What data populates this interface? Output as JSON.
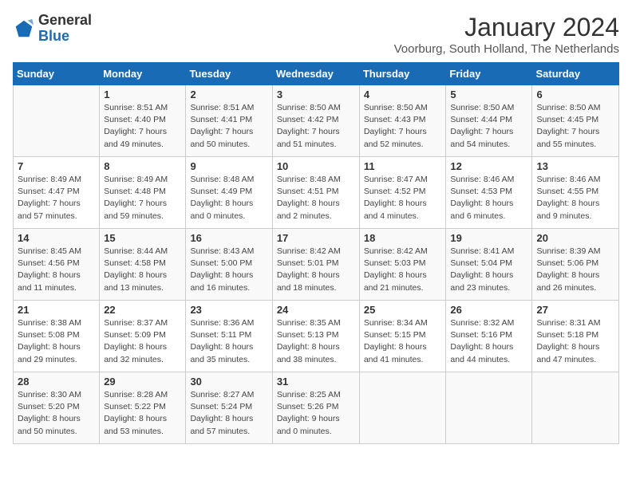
{
  "header": {
    "logo_general": "General",
    "logo_blue": "Blue",
    "title": "January 2024",
    "subtitle": "Voorburg, South Holland, The Netherlands"
  },
  "weekdays": [
    "Sunday",
    "Monday",
    "Tuesday",
    "Wednesday",
    "Thursday",
    "Friday",
    "Saturday"
  ],
  "weeks": [
    [
      {
        "day": "",
        "sunrise": "",
        "sunset": "",
        "daylight": ""
      },
      {
        "day": "1",
        "sunrise": "8:51 AM",
        "sunset": "4:40 PM",
        "daylight": "7 hours and 49 minutes."
      },
      {
        "day": "2",
        "sunrise": "8:51 AM",
        "sunset": "4:41 PM",
        "daylight": "7 hours and 50 minutes."
      },
      {
        "day": "3",
        "sunrise": "8:50 AM",
        "sunset": "4:42 PM",
        "daylight": "7 hours and 51 minutes."
      },
      {
        "day": "4",
        "sunrise": "8:50 AM",
        "sunset": "4:43 PM",
        "daylight": "7 hours and 52 minutes."
      },
      {
        "day": "5",
        "sunrise": "8:50 AM",
        "sunset": "4:44 PM",
        "daylight": "7 hours and 54 minutes."
      },
      {
        "day": "6",
        "sunrise": "8:50 AM",
        "sunset": "4:45 PM",
        "daylight": "7 hours and 55 minutes."
      }
    ],
    [
      {
        "day": "7",
        "sunrise": "8:49 AM",
        "sunset": "4:47 PM",
        "daylight": "7 hours and 57 minutes."
      },
      {
        "day": "8",
        "sunrise": "8:49 AM",
        "sunset": "4:48 PM",
        "daylight": "7 hours and 59 minutes."
      },
      {
        "day": "9",
        "sunrise": "8:48 AM",
        "sunset": "4:49 PM",
        "daylight": "8 hours and 0 minutes."
      },
      {
        "day": "10",
        "sunrise": "8:48 AM",
        "sunset": "4:51 PM",
        "daylight": "8 hours and 2 minutes."
      },
      {
        "day": "11",
        "sunrise": "8:47 AM",
        "sunset": "4:52 PM",
        "daylight": "8 hours and 4 minutes."
      },
      {
        "day": "12",
        "sunrise": "8:46 AM",
        "sunset": "4:53 PM",
        "daylight": "8 hours and 6 minutes."
      },
      {
        "day": "13",
        "sunrise": "8:46 AM",
        "sunset": "4:55 PM",
        "daylight": "8 hours and 9 minutes."
      }
    ],
    [
      {
        "day": "14",
        "sunrise": "8:45 AM",
        "sunset": "4:56 PM",
        "daylight": "8 hours and 11 minutes."
      },
      {
        "day": "15",
        "sunrise": "8:44 AM",
        "sunset": "4:58 PM",
        "daylight": "8 hours and 13 minutes."
      },
      {
        "day": "16",
        "sunrise": "8:43 AM",
        "sunset": "5:00 PM",
        "daylight": "8 hours and 16 minutes."
      },
      {
        "day": "17",
        "sunrise": "8:42 AM",
        "sunset": "5:01 PM",
        "daylight": "8 hours and 18 minutes."
      },
      {
        "day": "18",
        "sunrise": "8:42 AM",
        "sunset": "5:03 PM",
        "daylight": "8 hours and 21 minutes."
      },
      {
        "day": "19",
        "sunrise": "8:41 AM",
        "sunset": "5:04 PM",
        "daylight": "8 hours and 23 minutes."
      },
      {
        "day": "20",
        "sunrise": "8:39 AM",
        "sunset": "5:06 PM",
        "daylight": "8 hours and 26 minutes."
      }
    ],
    [
      {
        "day": "21",
        "sunrise": "8:38 AM",
        "sunset": "5:08 PM",
        "daylight": "8 hours and 29 minutes."
      },
      {
        "day": "22",
        "sunrise": "8:37 AM",
        "sunset": "5:09 PM",
        "daylight": "8 hours and 32 minutes."
      },
      {
        "day": "23",
        "sunrise": "8:36 AM",
        "sunset": "5:11 PM",
        "daylight": "8 hours and 35 minutes."
      },
      {
        "day": "24",
        "sunrise": "8:35 AM",
        "sunset": "5:13 PM",
        "daylight": "8 hours and 38 minutes."
      },
      {
        "day": "25",
        "sunrise": "8:34 AM",
        "sunset": "5:15 PM",
        "daylight": "8 hours and 41 minutes."
      },
      {
        "day": "26",
        "sunrise": "8:32 AM",
        "sunset": "5:16 PM",
        "daylight": "8 hours and 44 minutes."
      },
      {
        "day": "27",
        "sunrise": "8:31 AM",
        "sunset": "5:18 PM",
        "daylight": "8 hours and 47 minutes."
      }
    ],
    [
      {
        "day": "28",
        "sunrise": "8:30 AM",
        "sunset": "5:20 PM",
        "daylight": "8 hours and 50 minutes."
      },
      {
        "day": "29",
        "sunrise": "8:28 AM",
        "sunset": "5:22 PM",
        "daylight": "8 hours and 53 minutes."
      },
      {
        "day": "30",
        "sunrise": "8:27 AM",
        "sunset": "5:24 PM",
        "daylight": "8 hours and 57 minutes."
      },
      {
        "day": "31",
        "sunrise": "8:25 AM",
        "sunset": "5:26 PM",
        "daylight": "9 hours and 0 minutes."
      },
      {
        "day": "",
        "sunrise": "",
        "sunset": "",
        "daylight": ""
      },
      {
        "day": "",
        "sunrise": "",
        "sunset": "",
        "daylight": ""
      },
      {
        "day": "",
        "sunrise": "",
        "sunset": "",
        "daylight": ""
      }
    ]
  ]
}
